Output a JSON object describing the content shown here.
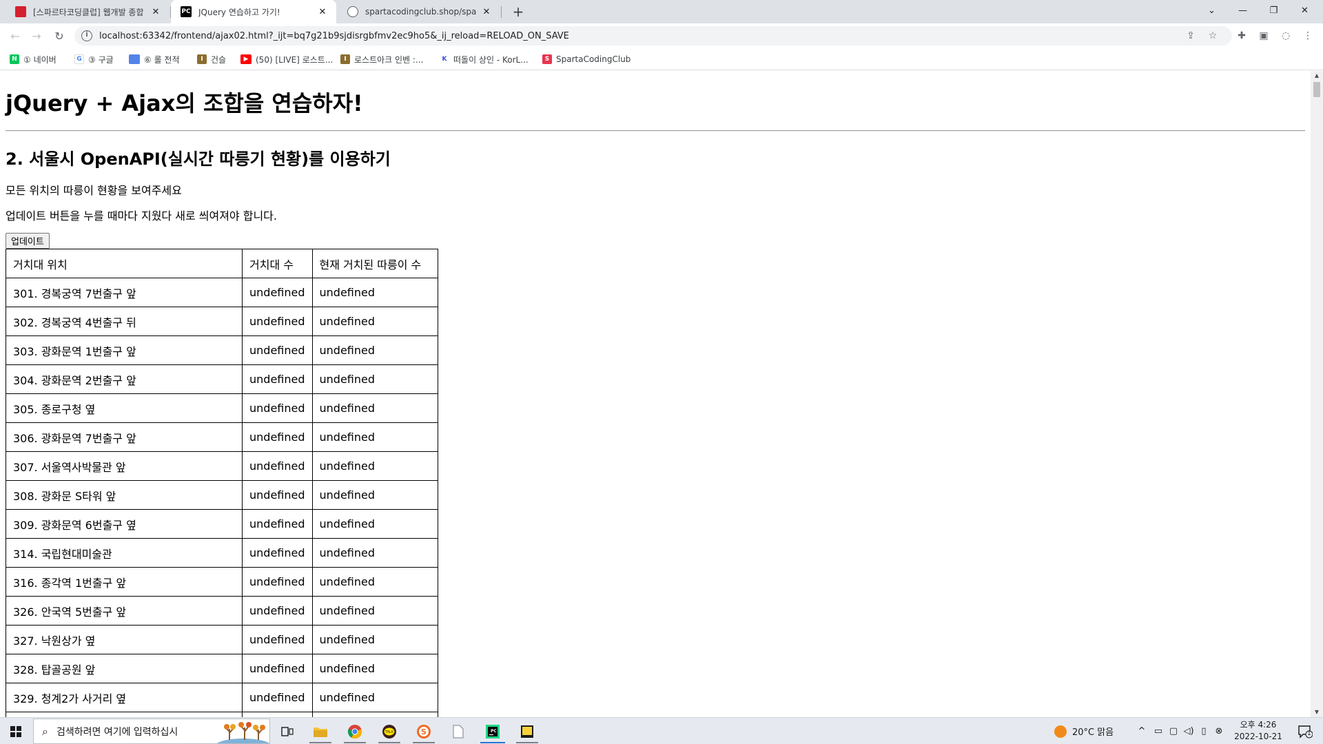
{
  "browser": {
    "tabs": [
      {
        "title": "[스파르타코딩클럽] 웹개발 종합",
        "favicon": "bookmark-red-icon",
        "active": false
      },
      {
        "title": "JQuery 연습하고 가기!",
        "favicon": "pycharm-icon",
        "active": true
      },
      {
        "title": "spartacodingclub.shop/sparta_a",
        "favicon": "globe-icon",
        "active": false
      }
    ],
    "new_tab_glyph": "+",
    "url": "localhost:63342/frontend/ajax02.html?_ijt=bq7g21b9sjdisrgbfmv2ec9ho5&_ij_reload=RELOAD_ON_SAVE",
    "bookmarks": [
      {
        "label": "① 네이버",
        "icon": "naver-icon",
        "color": "#03c75a"
      },
      {
        "label": "③ 구글",
        "icon": "google-icon",
        "color": "#4285f4"
      },
      {
        "label": "⑥ 롤 전적",
        "icon": "opgg-icon",
        "color": "#5383e8"
      },
      {
        "label": "건슬",
        "icon": "lostark-icon",
        "color": "#8a6d2f"
      },
      {
        "label": "(50) [LIVE] 로스트...",
        "icon": "youtube-icon",
        "color": "#ff0000"
      },
      {
        "label": "로스트아크 인벤 :...",
        "icon": "inven-icon",
        "color": "#8a6d2f"
      },
      {
        "label": "떠돌이 상인 - KorL...",
        "icon": "korlark-icon",
        "color": "#3b4fd8"
      },
      {
        "label": "SpartaCodingClub",
        "icon": "sparta-icon",
        "color": "#e8344e"
      }
    ]
  },
  "page": {
    "title": "jQuery + Ajax의 조합을 연습하자!",
    "section_title": "2. 서울시 OpenAPI(실시간 따릉기 현황)를 이용하기",
    "desc1": "모든 위치의 따릉이 현황을 보여주세요",
    "desc2": "업데이트 버튼을 누를 때마다 지웠다 새로 씌여져야 합니다.",
    "update_button": "업데이트",
    "table": {
      "headers": [
        "거치대 위치",
        "거치대 수",
        "현재 거치된 따릉이 수"
      ],
      "rows": [
        [
          "301. 경복궁역 7번출구 앞",
          "undefined",
          "undefined"
        ],
        [
          "302. 경복궁역 4번출구 뒤",
          "undefined",
          "undefined"
        ],
        [
          "303. 광화문역 1번출구 앞",
          "undefined",
          "undefined"
        ],
        [
          "304. 광화문역 2번출구 앞",
          "undefined",
          "undefined"
        ],
        [
          "305. 종로구청 옆",
          "undefined",
          "undefined"
        ],
        [
          "306. 광화문역 7번출구 앞",
          "undefined",
          "undefined"
        ],
        [
          "307. 서울역사박물관 앞",
          "undefined",
          "undefined"
        ],
        [
          "308. 광화문 S타워 앞",
          "undefined",
          "undefined"
        ],
        [
          "309. 광화문역 6번출구 옆",
          "undefined",
          "undefined"
        ],
        [
          "314. 국립현대미술관",
          "undefined",
          "undefined"
        ],
        [
          "316. 종각역 1번출구 앞",
          "undefined",
          "undefined"
        ],
        [
          "326. 안국역 5번출구 앞",
          "undefined",
          "undefined"
        ],
        [
          "327. 낙원상가 옆",
          "undefined",
          "undefined"
        ],
        [
          "328. 탑골공원 앞",
          "undefined",
          "undefined"
        ],
        [
          "329. 청계2가 사거리 옆",
          "undefined",
          "undefined"
        ],
        [
          "",
          "",
          ""
        ]
      ]
    }
  },
  "taskbar": {
    "search_placeholder": "검색하려면 여기에 입력하십시",
    "weather": "20°C  맑음",
    "time": "오후 4:26",
    "date": "2022-10-21",
    "notification_count": "1"
  }
}
